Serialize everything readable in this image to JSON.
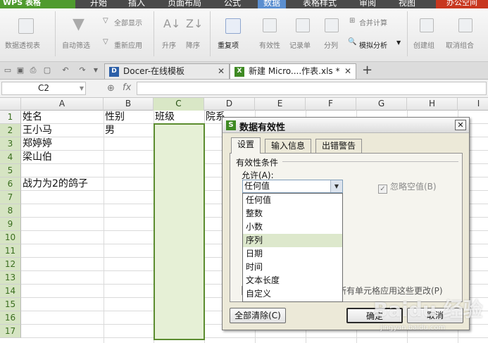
{
  "menubar": {
    "app": "WPS 表格",
    "items": [
      "开始",
      "插入",
      "页面布局",
      "公式",
      "数据",
      "表格样式",
      "审阅",
      "视图"
    ],
    "active": "数据",
    "office": "办公空间"
  },
  "ribbon": {
    "pivot": "数据透视表",
    "auto_filter": "自动筛选",
    "show_all": "全部显示",
    "reapply": "重新应用",
    "sort_asc": "升序",
    "sort_desc": "降序",
    "duplicates": "重复项",
    "validity": "有效性",
    "record": "记录单",
    "split": "分列",
    "merge_calc": "合并计算",
    "simulate": "模拟分析",
    "group": "创建组",
    "ungroup": "取消组合"
  },
  "tabs": [
    {
      "label": "Docer-在线模板"
    },
    {
      "label": "新建 Micro....作表.xls *"
    }
  ],
  "formula": {
    "cell_ref": "C2",
    "fx": "fx"
  },
  "grid": {
    "columns": [
      "A",
      "B",
      "C",
      "D",
      "E",
      "F",
      "G",
      "H",
      "I"
    ],
    "rows": [
      "1",
      "2",
      "3",
      "4",
      "5",
      "6",
      "7",
      "8",
      "9",
      "10",
      "11",
      "12",
      "13",
      "14",
      "15",
      "16",
      "17"
    ],
    "cells": {
      "A1": "姓名",
      "B1": "性别",
      "C1": "班级",
      "D1": "院系",
      "A2": "王小马",
      "B2": "男",
      "A3": "郑婷婷",
      "A4": "梁山伯",
      "A6": "战力为2的鸽子"
    }
  },
  "dialog": {
    "title": "数据有效性",
    "tabs": [
      "设置",
      "输入信息",
      "出错警告"
    ],
    "criteria_label": "有效性条件",
    "allow_label": "允许(A):",
    "allow_value": "任何值",
    "options": [
      "任何值",
      "整数",
      "小数",
      "序列",
      "日期",
      "时间",
      "文本长度",
      "自定义"
    ],
    "highlighted_option": "序列",
    "ignore_blank": "忽略空值(B)",
    "apply_all": "对所有同样设置的其他所有单元格应用这些更改(P)",
    "clear_all": "全部清除(C)",
    "ok": "确定",
    "cancel": "取消"
  },
  "watermark": {
    "brand": "Baidu 经验",
    "url": "jingyan.baidu.com"
  }
}
